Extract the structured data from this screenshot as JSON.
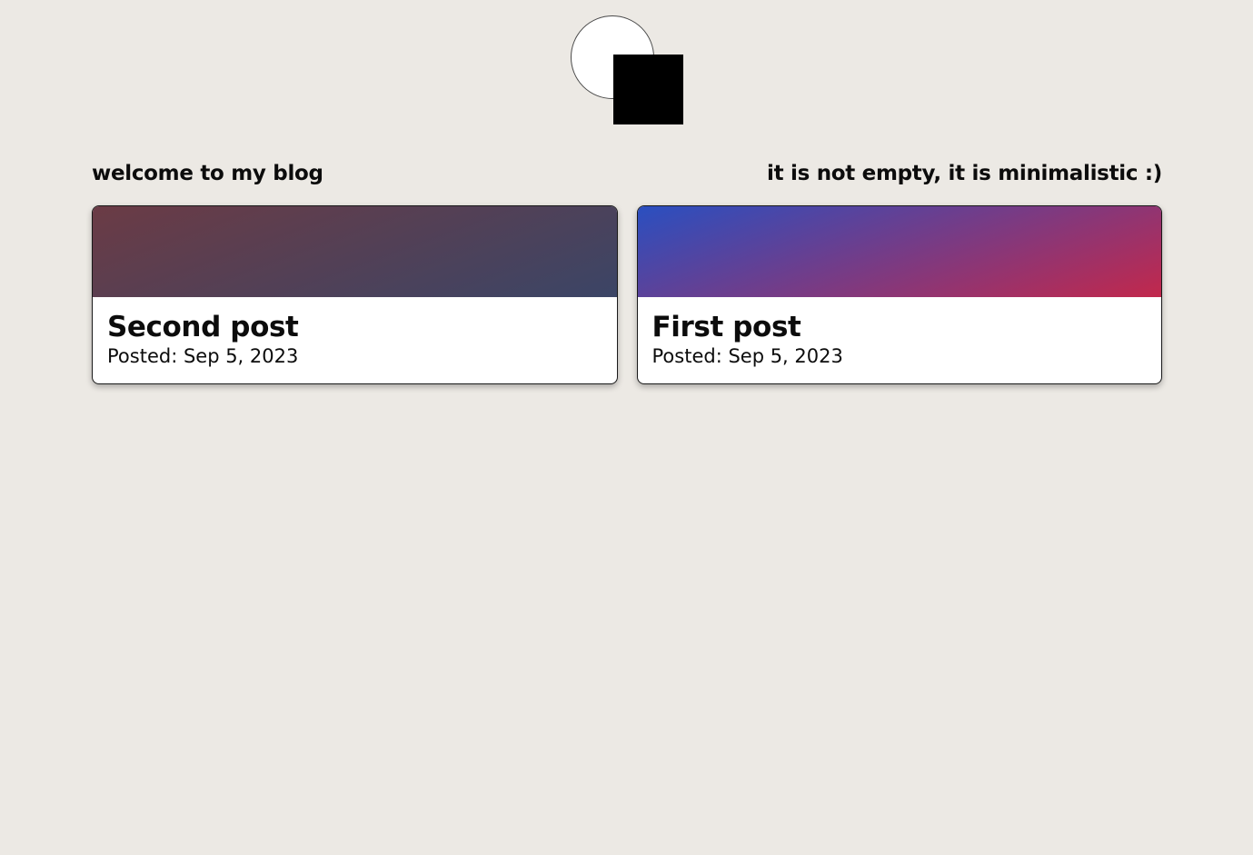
{
  "header": {
    "logo": "circle-and-square-logo",
    "tagline_left": "welcome to my blog",
    "tagline_right": "it is not empty, it is minimalistic :)"
  },
  "posts": [
    {
      "title": "Second post",
      "date": "Posted: Sep 5, 2023",
      "banner_gradient": [
        "#6b3b45",
        "#3b4566"
      ]
    },
    {
      "title": "First post",
      "date": "Posted: Sep 5, 2023",
      "banner_gradient": [
        "#2a4fc0",
        "#c2284c"
      ]
    }
  ],
  "colors": {
    "background": "#ece9e4",
    "card_background": "#ffffff",
    "text": "#0c0c0c"
  }
}
